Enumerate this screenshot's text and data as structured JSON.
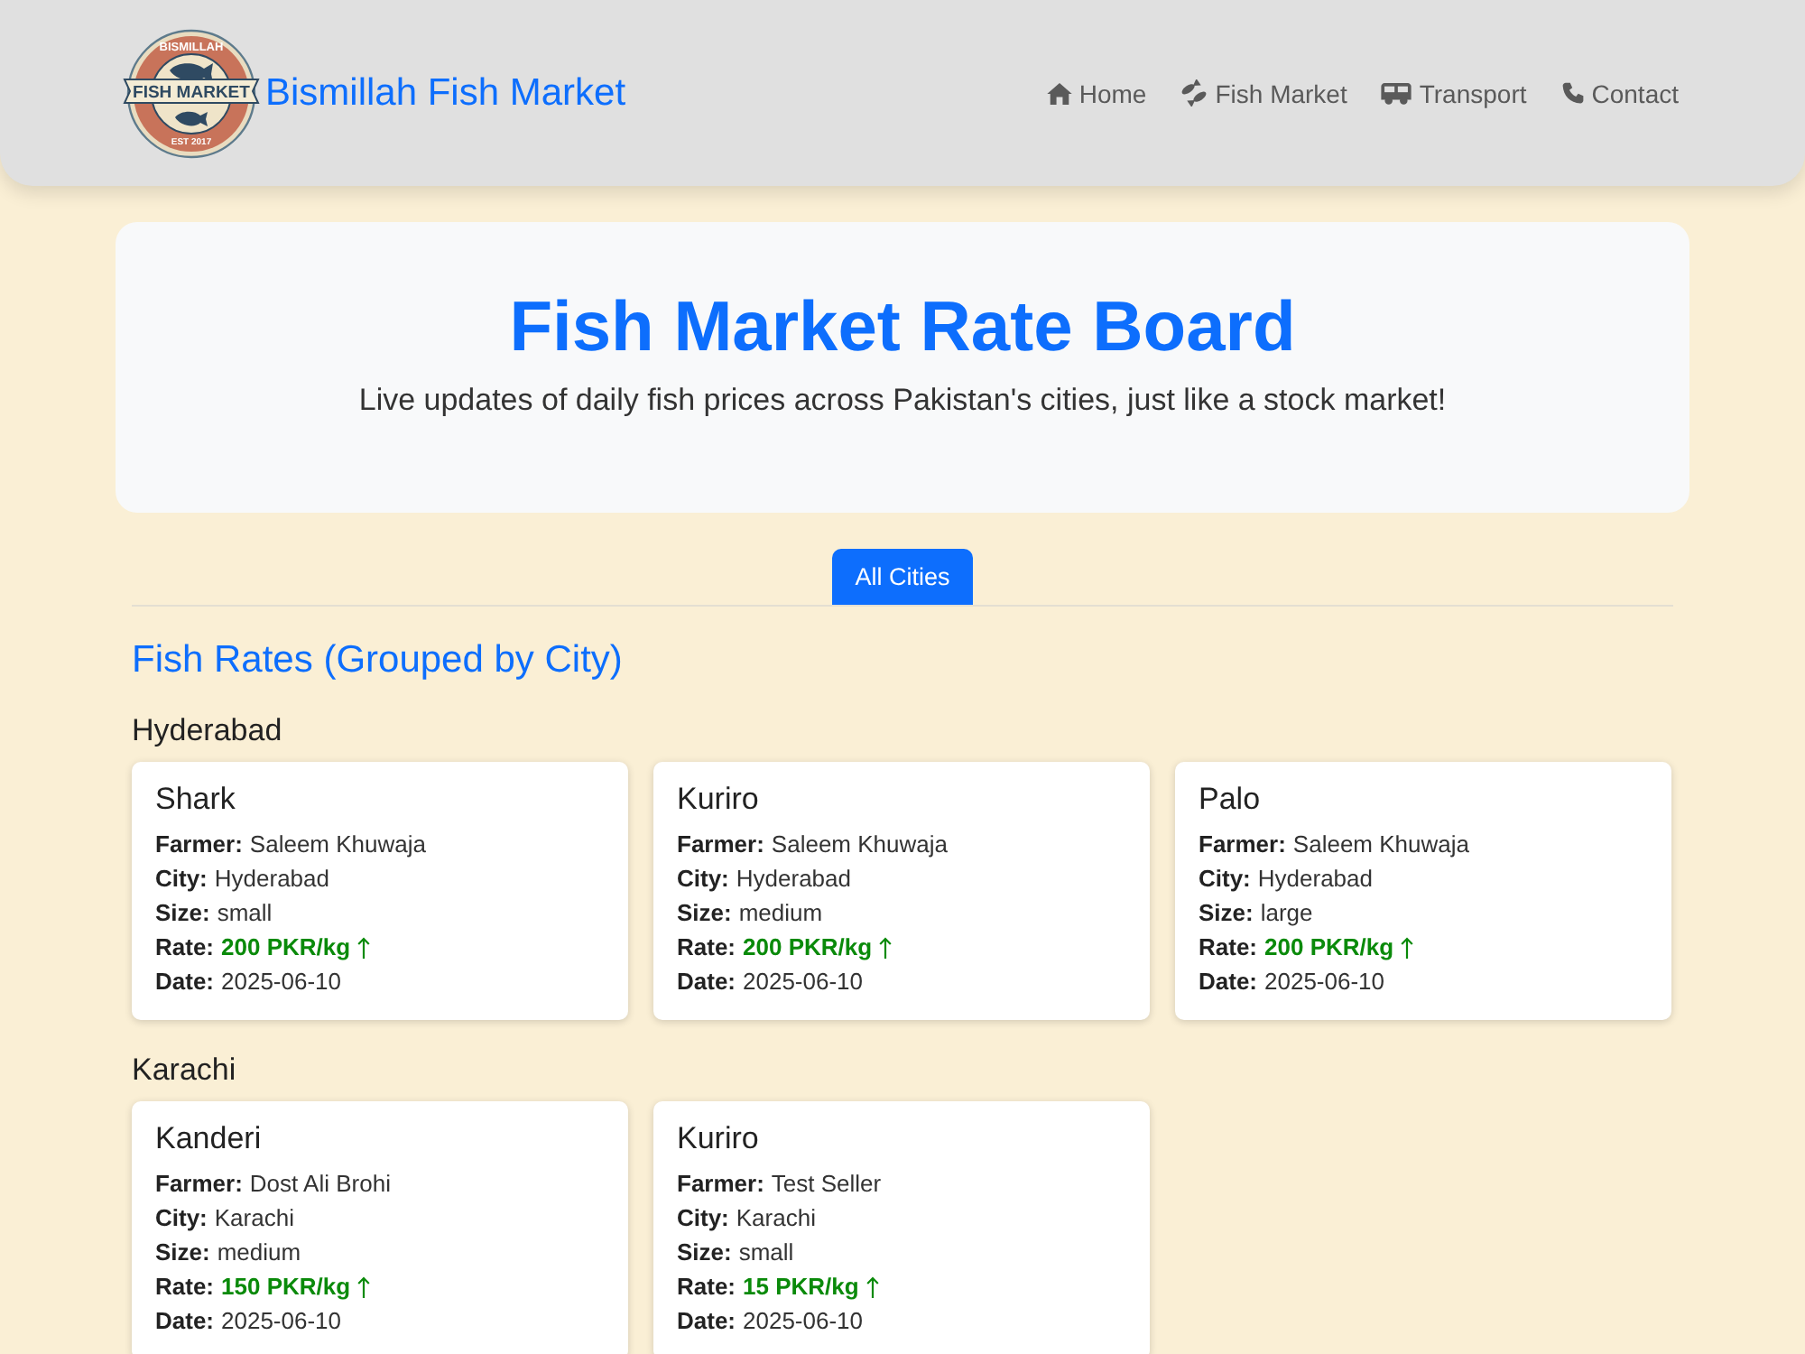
{
  "header": {
    "logo": {
      "top_text": "BISMILLAH",
      "banner_text": "FISH MARKET",
      "bottom_text": "EST 2017"
    },
    "brand": "Bismillah Fish Market",
    "nav": [
      "Home",
      "Fish Market",
      "Transport",
      "Contact"
    ]
  },
  "hero": {
    "title": "Fish Market Rate Board",
    "subtitle": "Live updates of daily fish prices across Pakistan's cities, just like a stock market!"
  },
  "tabs": [
    {
      "label": "All Cities",
      "selected": true
    }
  ],
  "section_title": "Fish Rates (Grouped by City)",
  "groups": [
    {
      "city": "Hyderabad",
      "cards": [
        {
          "name": "Shark",
          "fields": [
            {
              "kind": "text",
              "label": "Farmer:",
              "value": "Saleem Khuwaja"
            },
            {
              "kind": "text",
              "label": "City:",
              "value": "Hyderabad"
            },
            {
              "kind": "text",
              "label": "Size:",
              "value": "small"
            },
            {
              "kind": "rate",
              "label": "Rate:",
              "value": "200 PKR/kg",
              "rising": true
            },
            {
              "kind": "text",
              "label": "Date:",
              "value": "2025-06-10"
            }
          ]
        },
        {
          "name": "Kuriro",
          "fields": [
            {
              "kind": "text",
              "label": "Farmer:",
              "value": "Saleem Khuwaja"
            },
            {
              "kind": "text",
              "label": "City:",
              "value": "Hyderabad"
            },
            {
              "kind": "text",
              "label": "Size:",
              "value": "medium"
            },
            {
              "kind": "rate",
              "label": "Rate:",
              "value": "200 PKR/kg",
              "rising": true
            },
            {
              "kind": "text",
              "label": "Date:",
              "value": "2025-06-10"
            }
          ]
        },
        {
          "name": "Palo",
          "fields": [
            {
              "kind": "text",
              "label": "Farmer:",
              "value": "Saleem Khuwaja"
            },
            {
              "kind": "text",
              "label": "City:",
              "value": "Hyderabad"
            },
            {
              "kind": "text",
              "label": "Size:",
              "value": "large"
            },
            {
              "kind": "rate",
              "label": "Rate:",
              "value": "200 PKR/kg",
              "rising": true
            },
            {
              "kind": "text",
              "label": "Date:",
              "value": "2025-06-10"
            }
          ]
        }
      ]
    },
    {
      "city": "Karachi",
      "cards": [
        {
          "name": "Kanderi",
          "fields": [
            {
              "kind": "text",
              "label": "Farmer:",
              "value": "Dost Ali Brohi"
            },
            {
              "kind": "text",
              "label": "City:",
              "value": "Karachi"
            },
            {
              "kind": "text",
              "label": "Size:",
              "value": "medium"
            },
            {
              "kind": "rate",
              "label": "Rate:",
              "value": "150 PKR/kg",
              "rising": true
            },
            {
              "kind": "text",
              "label": "Date:",
              "value": "2025-06-10"
            }
          ]
        },
        {
          "name": "Kuriro",
          "fields": [
            {
              "kind": "text",
              "label": "Farmer:",
              "value": "Test Seller"
            },
            {
              "kind": "text",
              "label": "City:",
              "value": "Karachi"
            },
            {
              "kind": "text",
              "label": "Size:",
              "value": "small"
            },
            {
              "kind": "rate",
              "label": "Rate:",
              "value": "15 PKR/kg",
              "rising": true
            },
            {
              "kind": "text",
              "label": "Date:",
              "value": "2025-06-10"
            }
          ]
        }
      ]
    }
  ]
}
